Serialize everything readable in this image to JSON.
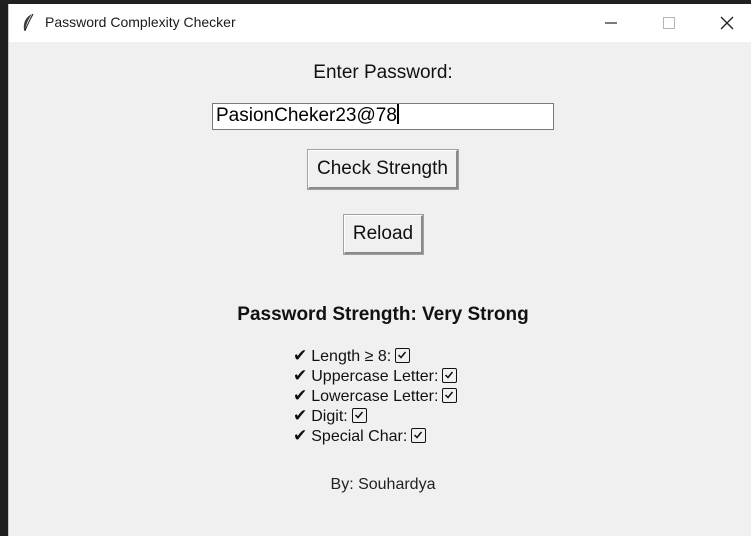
{
  "window": {
    "title": "Password Complexity Checker",
    "icon": "feather-icon"
  },
  "form": {
    "prompt_label": "Enter Password:",
    "password_value": "PasionCheker23@78",
    "check_button_label": "Check Strength",
    "reload_button_label": "Reload"
  },
  "result": {
    "strength_text": "Password Strength: Very Strong",
    "criteria": [
      {
        "tick": "✔",
        "label": "Length ≥ 8:",
        "met": true
      },
      {
        "tick": "✔",
        "label": "Uppercase Letter:",
        "met": true
      },
      {
        "tick": "✔",
        "label": "Lowercase Letter:",
        "met": true
      },
      {
        "tick": "✔",
        "label": "Digit:",
        "met": true
      },
      {
        "tick": "✔",
        "label": "Special Char:",
        "met": true
      }
    ]
  },
  "footer": {
    "author": "By: Souhardya"
  },
  "colors": {
    "window_bg": "#f0f0f0",
    "titlebar_bg": "#ffffff",
    "text": "#111111"
  }
}
